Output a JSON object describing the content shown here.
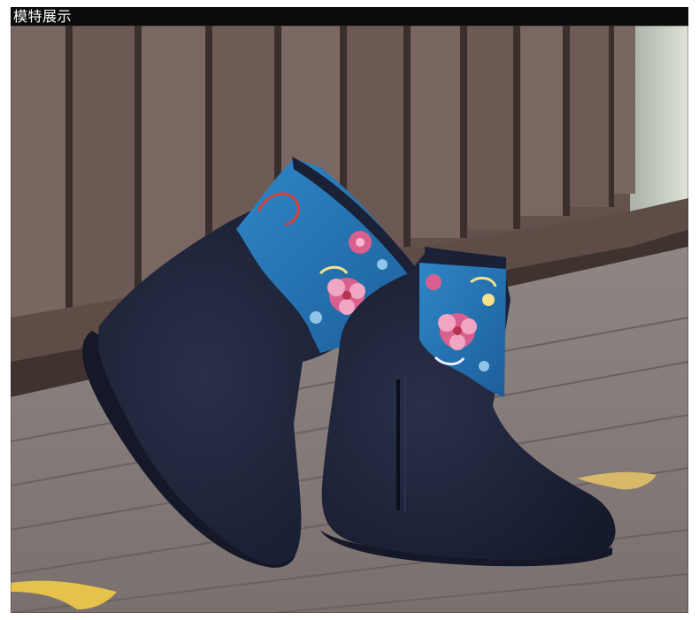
{
  "header": {
    "title": "模特展示"
  },
  "photo": {
    "subject": "embroidered-ankle-boots",
    "colors": {
      "fabric": "#1d2236",
      "embroidery_blue": "#2a78b8",
      "flower_pink": "#d9608e",
      "wood": "#6b5750",
      "floor": "#8a7f7c",
      "leaf": "#e6c24a"
    }
  }
}
